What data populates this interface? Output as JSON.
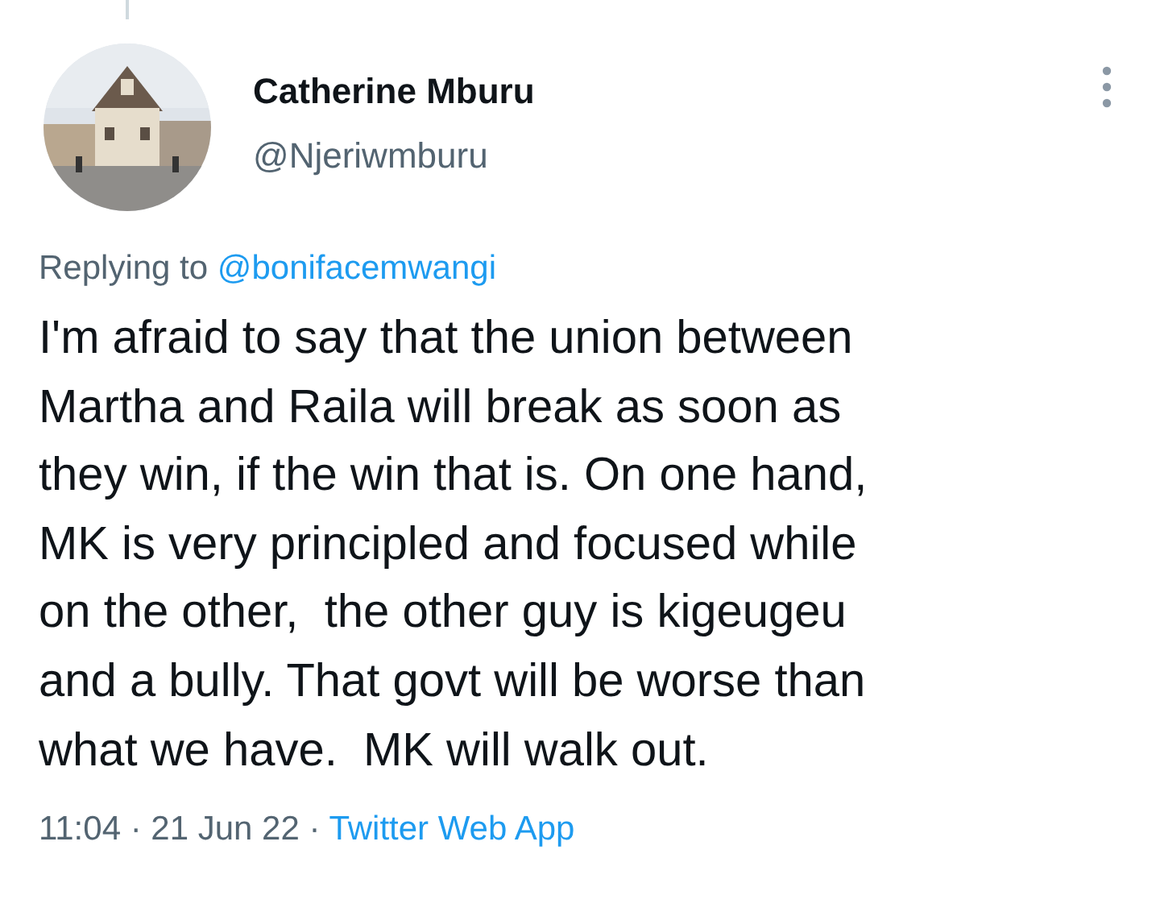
{
  "author": {
    "name": "Catherine Mburu",
    "handle": "@Njeriwmburu"
  },
  "reply_to": {
    "prefix": "Replying to ",
    "handle": "@bonifacemwangi"
  },
  "body": "I'm afraid to say that the union between\nMartha and Raila will break as soon as\nthey win, if the win that is. On one hand,\nMK is very principled and focused while\non the other,  the other guy is kigeugeu\nand a bully. That govt will be worse than\nwhat we have.  MK will walk out.",
  "meta": {
    "time": "11:04 · 21 Jun 22 · ",
    "source": "Twitter Web App"
  }
}
